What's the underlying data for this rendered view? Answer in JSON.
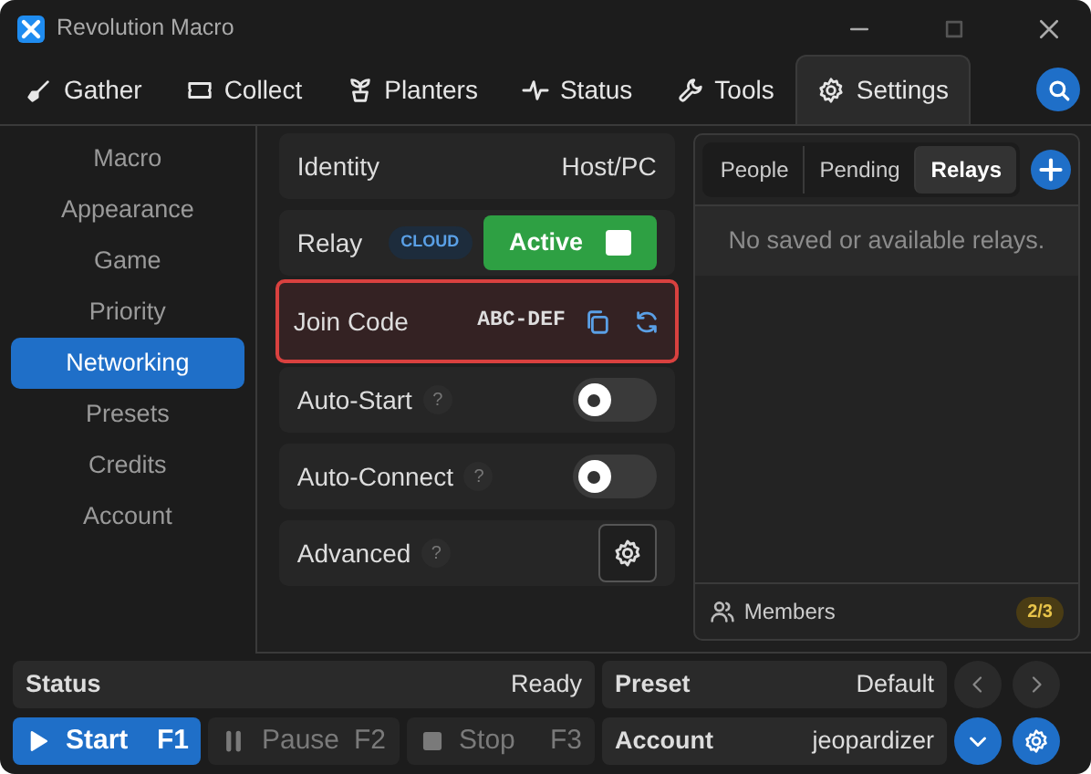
{
  "window": {
    "title": "Revolution Macro"
  },
  "tabs": [
    {
      "label": "Gather",
      "selected": false
    },
    {
      "label": "Collect",
      "selected": false
    },
    {
      "label": "Planters",
      "selected": false
    },
    {
      "label": "Status",
      "selected": false
    },
    {
      "label": "Tools",
      "selected": false
    },
    {
      "label": "Settings",
      "selected": true
    }
  ],
  "sidebar": {
    "items": [
      {
        "label": "Macro",
        "selected": false
      },
      {
        "label": "Appearance",
        "selected": false
      },
      {
        "label": "Game",
        "selected": false
      },
      {
        "label": "Priority",
        "selected": false
      },
      {
        "label": "Networking",
        "selected": true
      },
      {
        "label": "Presets",
        "selected": false
      },
      {
        "label": "Credits",
        "selected": false
      },
      {
        "label": "Account",
        "selected": false
      }
    ]
  },
  "settings": [
    {
      "kind": "value",
      "label": "Identity",
      "value": "Host/PC",
      "highlighted": false
    },
    {
      "kind": "relay",
      "label": "Relay",
      "badge": "CLOUD",
      "button": "Active",
      "active": true,
      "highlighted": false
    },
    {
      "kind": "code",
      "label": "Join Code",
      "value": "ABC-DEF",
      "highlighted": true
    },
    {
      "kind": "toggle",
      "label": "Auto-Start",
      "help": "?",
      "on": false,
      "highlighted": false
    },
    {
      "kind": "toggle",
      "label": "Auto-Connect",
      "help": "?",
      "on": false,
      "highlighted": false
    },
    {
      "kind": "button",
      "label": "Advanced",
      "help": "?",
      "highlighted": false
    }
  ],
  "peers": {
    "tabs": [
      {
        "label": "People",
        "selected": false
      },
      {
        "label": "Pending",
        "selected": false
      },
      {
        "label": "Relays",
        "selected": true
      }
    ],
    "empty_message": "No saved or available relays.",
    "footer": {
      "label": "Members",
      "count": "2/3"
    }
  },
  "status_bar": {
    "status": {
      "label": "Status",
      "value": "Ready"
    },
    "preset": {
      "label": "Preset",
      "value": "Default"
    },
    "controls": [
      {
        "label": "Start",
        "key": "F1",
        "disabled": false
      },
      {
        "label": "Pause",
        "key": "F2",
        "disabled": true
      },
      {
        "label": "Stop",
        "key": "F3",
        "disabled": true
      }
    ],
    "account": {
      "label": "Account",
      "value": "jeopardizer"
    }
  }
}
